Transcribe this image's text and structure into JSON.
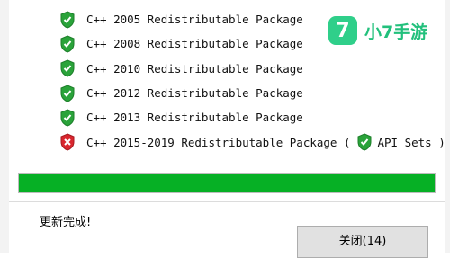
{
  "packages": [
    {
      "label": "C++ 2005 Redistributable Package",
      "status": "shield-check-icon"
    },
    {
      "label": "C++ 2008 Redistributable Package",
      "status": "shield-check-icon"
    },
    {
      "label": "C++ 2010 Redistributable Package",
      "status": "shield-check-icon"
    },
    {
      "label": "C++ 2012 Redistributable Package",
      "status": "shield-check-icon"
    },
    {
      "label": "C++ 2013 Redistributable Package",
      "status": "shield-check-icon"
    },
    {
      "label": "C++ 2015-2019 Redistributable Package (",
      "status": "shield-x-icon",
      "extra_icon": "shield-check-icon",
      "extra_label": "API Sets )"
    }
  ],
  "progress": {
    "value": 1.0,
    "color": "#06b025"
  },
  "status_text": "更新完成!",
  "close_button": "关闭(14)",
  "watermark": {
    "badge": "7",
    "text": "小7手游",
    "color": "#2fcf8a"
  },
  "colors": {
    "check": "#2aa33a",
    "error": "#d9262e"
  }
}
